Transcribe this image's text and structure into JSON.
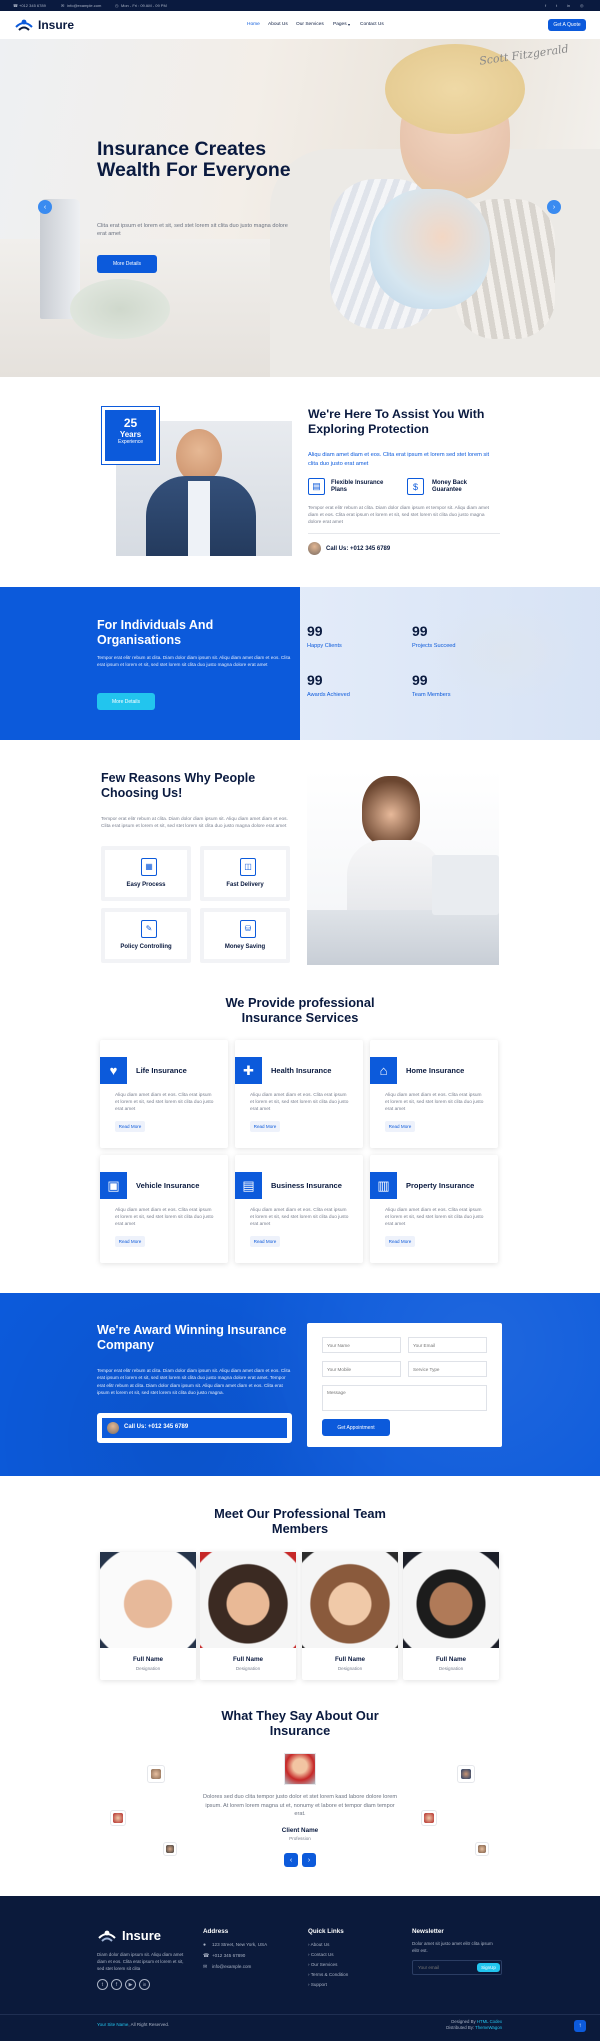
{
  "topbar": {
    "phone": "+012 345 6789",
    "email": "info@example.com",
    "hours": "Mon - Fri : 09 AM - 09 PM"
  },
  "nav": {
    "brand": "Insure",
    "links": [
      "Home",
      "About Us",
      "Our Services",
      "Pages",
      "Contact Us"
    ],
    "cta": "Get A Quote"
  },
  "hero": {
    "title": "Insurance Creates Wealth For Everyone",
    "text": "Clita erat ipsum et lorem et sit, sed stet lorem sit clita duo justo magna dolore erat amet",
    "button": "More Details",
    "signature": "Scott Fitzgerald"
  },
  "about": {
    "years": "25",
    "years_label": "Years",
    "exp": "Experience",
    "title": "We're Here To Assist You With Exploring Protection",
    "lead": "Aliqu diam amet diam et eos. Clita erat ipsum et lorem sed stet lorem sit clita duo justo erat amet",
    "feature1": "Flexible Insurance Plans",
    "feature2": "Money Back Guarantee",
    "text": "Tempor erat elitr rebum at clita. Diam dolor diam ipsum et tempor sit. Aliqu diam amet diam et eos. Clita erat ipsum et lorem et sit, sed stet lorem sit clita duo justo magna dolore erat amet",
    "call": "Call Us: +012 345 6789"
  },
  "facts": {
    "title": "For Individuals And Organisations",
    "text": "Tempor erat elitr rebum at clita. Diam dolor diam ipsum sit. Aliqu diam amet diam et eos. Clita erat ipsum et lorem et sit, sed stet lorem sit clita duo justo magna dolore erat amet",
    "button": "More Details",
    "items": [
      {
        "num": "99",
        "label": "Happy Clients"
      },
      {
        "num": "99",
        "label": "Projects Succeed"
      },
      {
        "num": "99",
        "label": "Awards Achieved"
      },
      {
        "num": "99",
        "label": "Team Members"
      }
    ]
  },
  "why": {
    "title": "Few Reasons Why People Choosing Us!",
    "text": "Tempor erat elitr rebum at clita. Diam dolor diam ipsum sit. Aliqu diam amet diam et eos. Clita erat ipsum et lorem et sit, sed stet lorem sit clita duo justo magna dolore erat amet",
    "items": [
      "Easy Process",
      "Fast Delivery",
      "Policy Controlling",
      "Money Saving"
    ]
  },
  "services": {
    "title": "We Provide professional Insurance Services",
    "text": "Aliqu diam amet diam et eos. Clita erat ipsum et lorem et sit, sed stet lorem sit clita duo justo erat amet",
    "more": "Read More",
    "items": [
      "Life Insurance",
      "Health Insurance",
      "Home Insurance",
      "Vehicle Insurance",
      "Business Insurance",
      "Property Insurance"
    ]
  },
  "quote": {
    "title": "We're Award Winning Insurance Company",
    "text": "Tempor erat elitr rebum at clita. Diam dolor diam ipsum sit. Aliqu diam amet diam et eos. Clita erat ipsum et lorem et sit, sed stet lorem sit clita duo justo magna dolore erat amet. Tempor erat elitr rebum at clita. Diam dolor diam ipsum sit. Aliqu diam amet diam et eos. Clita erat ipsum et lorem et sit, sed stet lorem sit clita duo justo magna.",
    "call": "Call Us: +012 345 6789",
    "form": {
      "name": "Your Name",
      "email": "Your Email",
      "mobile": "Your Mobile",
      "service": "Service Type",
      "message": "Message",
      "submit": "Get Appointment"
    }
  },
  "team": {
    "title": "Meet Our Professional Team Members",
    "members": [
      {
        "name": "Full Name",
        "role": "Designation"
      },
      {
        "name": "Full Name",
        "role": "Designation"
      },
      {
        "name": "Full Name",
        "role": "Designation"
      },
      {
        "name": "Full Name",
        "role": "Designation"
      }
    ]
  },
  "testimonial": {
    "title": "What They Say About Our Insurance",
    "text": "Dolores sed duo clita tempor justo dolor et stet lorem kasd labore dolore lorem ipsum. At lorem lorem magna ut et, nonumy et labore et tempor diam tempor erat.",
    "name": "Client Name",
    "role": "Profession"
  },
  "footer": {
    "brand": "Insure",
    "about": "Diam dolor diam ipsum sit. Aliqu diam amet diam et eos. Clita erat ipsum et lorem et sit, sed stet lorem sit clita",
    "address_title": "Address",
    "address": [
      "123 Street, New York, USA",
      "+012 345 67890",
      "info@example.com"
    ],
    "links_title": "Quick Links",
    "links": [
      "About Us",
      "Contact Us",
      "Our Services",
      "Terms & Condition",
      "Support"
    ],
    "news_title": "Newsletter",
    "news_text": "Dolor amet sit justo amet elitr clita ipsum elitr est.",
    "news_placeholder": "Your email",
    "news_btn": "SignUp",
    "copy_site": "Your Site Name",
    "copy_rest": ", All Right Reserved.",
    "designed_pre": "Designed By ",
    "designed": "HTML Codex",
    "distributed_pre": "Distributed By: ",
    "distributed": "ThemeWagon"
  },
  "colors": {
    "primary": "#0c5adb",
    "dark": "#0a1a3f",
    "footer": "#0b1a3b"
  }
}
